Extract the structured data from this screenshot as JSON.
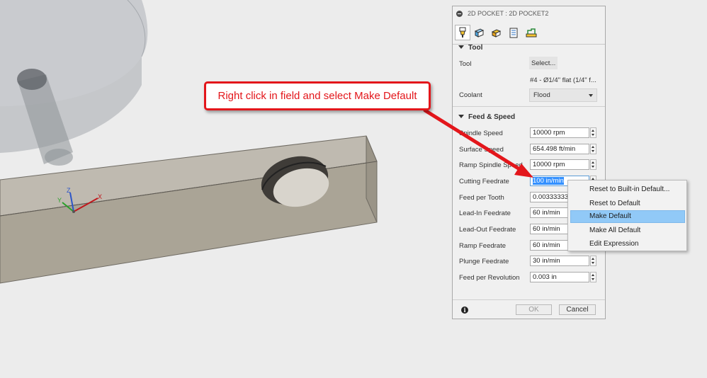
{
  "panel": {
    "title": "2D POCKET : 2D POCKET2",
    "tabs": [
      {
        "icon": "tool-tab-icon",
        "active": true
      },
      {
        "icon": "geometry-tab-icon"
      },
      {
        "icon": "heights-tab-icon"
      },
      {
        "icon": "passes-tab-icon"
      },
      {
        "icon": "linking-tab-icon"
      }
    ],
    "tool_section": {
      "title": "Tool",
      "tool_label": "Tool",
      "select_button": "Select...",
      "tool_description": "#4 - Ø1/4\" flat (1/4\" f...",
      "coolant_label": "Coolant",
      "coolant_value": "Flood"
    },
    "feed_section": {
      "title": "Feed & Speed",
      "rows": [
        {
          "label": "Spindle Speed",
          "value": "10000 rpm"
        },
        {
          "label": "Surface Speed",
          "value": "654.498 ft/min"
        },
        {
          "label": "Ramp Spindle Speed",
          "value": "10000 rpm"
        },
        {
          "label": "Cutting Feedrate",
          "value": "100 in/min"
        },
        {
          "label": "Feed per Tooth",
          "value": "0.00333333"
        },
        {
          "label": "Lead-In Feedrate",
          "value": "60 in/min"
        },
        {
          "label": "Lead-Out Feedrate",
          "value": "60 in/min"
        },
        {
          "label": "Ramp Feedrate",
          "value": "60 in/min"
        },
        {
          "label": "Plunge Feedrate",
          "value": "30 in/min"
        },
        {
          "label": "Feed per Revolution",
          "value": "0.003 in"
        }
      ]
    },
    "footer": {
      "info_glyph": "i",
      "ok_label": "OK",
      "cancel_label": "Cancel"
    }
  },
  "context_menu": {
    "items": [
      {
        "label": "Reset to Built-in Default..."
      },
      {
        "label": "Reset to Default"
      },
      {
        "label": "Make Default",
        "highlighted": true
      },
      {
        "label": "Make All Default"
      },
      {
        "label": "Edit Expression"
      }
    ]
  },
  "callout": {
    "text": "Right click in field and select Make Default",
    "color": "#e3161b"
  },
  "axis_triad": {
    "x_label": "X",
    "y_label": "Y",
    "z_label": "Z"
  },
  "colors": {
    "viewport_bg": "#ececec",
    "part_top": "#bfbab0",
    "part_front": "#aaa496",
    "menu_highlight": "#91c9f7",
    "text_selection": "#3390ff"
  }
}
